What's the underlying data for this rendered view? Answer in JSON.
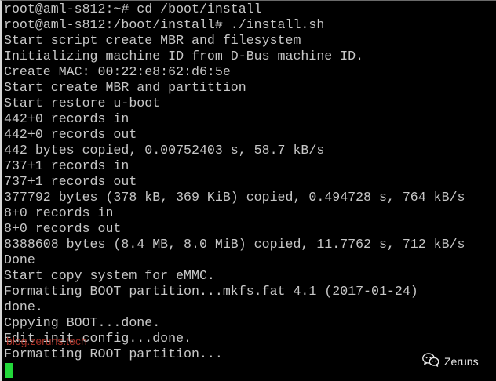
{
  "terminal": {
    "lines": [
      "root@aml-s812:~# cd /boot/install",
      "root@aml-s812:/boot/install# ./install.sh",
      "Start script create MBR and filesystem",
      "Initializing machine ID from D-Bus machine ID.",
      "Create MAC: 00:22:e8:62:d6:5e",
      "Start create MBR and partittion",
      "Start restore u-boot",
      "442+0 records in",
      "442+0 records out",
      "442 bytes copied, 0.00752403 s, 58.7 kB/s",
      "737+1 records in",
      "737+1 records out",
      "377792 bytes (378 kB, 369 KiB) copied, 0.494728 s, 764 kB/s",
      "8+0 records in",
      "8+0 records out",
      "8388608 bytes (8.4 MB, 8.0 MiB) copied, 11.7762 s, 712 kB/s",
      "Done",
      "Start copy system for eMMC.",
      "Formatting BOOT partition...mkfs.fat 4.1 (2017-01-24)",
      "done.",
      "Cppying BOOT...done.",
      "Edit init config...done.",
      "Formatting ROOT partition..."
    ],
    "text_color": "#c7c7c7",
    "background": "#000000",
    "cursor_color": "#22d83a"
  },
  "watermarks": {
    "site": "blog.zeruns.tech",
    "brand": "Zeruns",
    "brand_icon": "wechat-icon"
  }
}
